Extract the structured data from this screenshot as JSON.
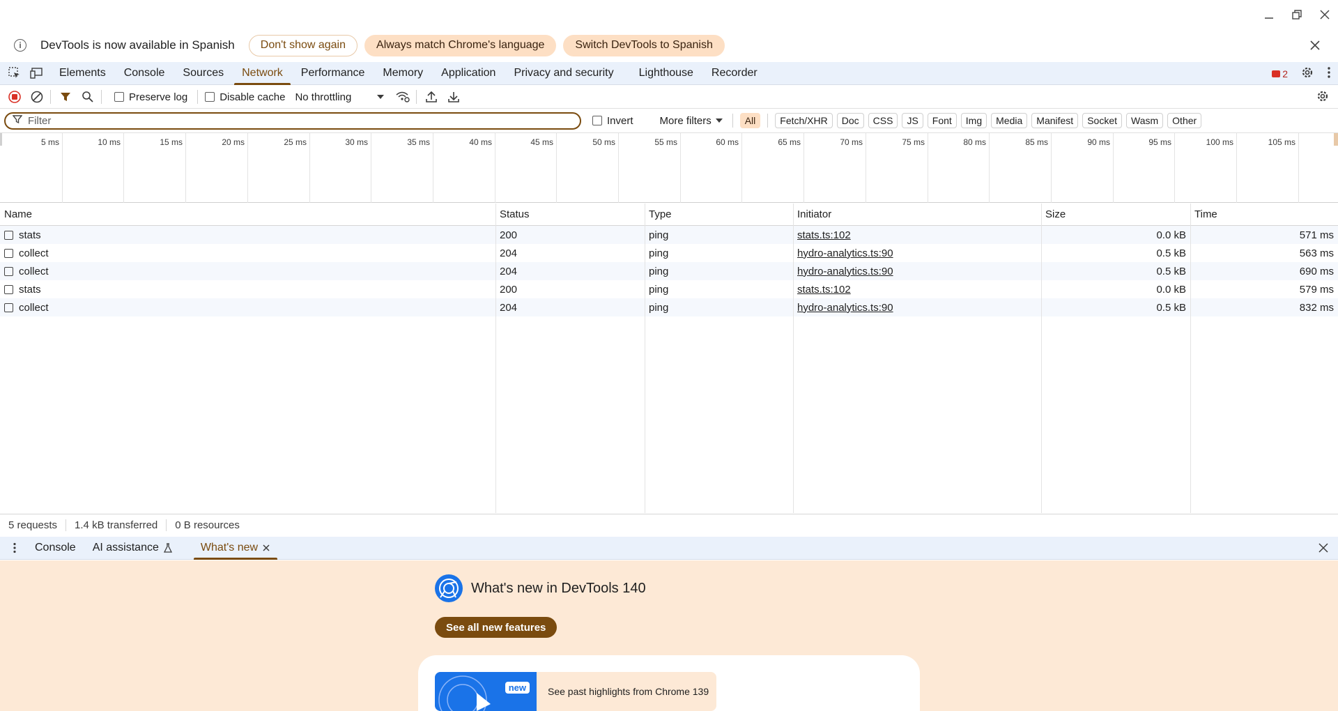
{
  "infobar": {
    "message": "DevTools is now available in Spanish",
    "dont_show": "Don't show again",
    "always_match": "Always match Chrome's language",
    "switch": "Switch DevTools to Spanish"
  },
  "tabs": [
    "Elements",
    "Console",
    "Sources",
    "Network",
    "Performance",
    "Memory",
    "Application",
    "Privacy and security",
    "Lighthouse",
    "Recorder"
  ],
  "active_tab": "Network",
  "issues_count": "2",
  "toolbar": {
    "preserve_log": "Preserve log",
    "disable_cache": "Disable cache",
    "throttling": "No throttling"
  },
  "filter": {
    "placeholder": "Filter",
    "invert": "Invert",
    "more_filters": "More filters",
    "types": [
      "All",
      "Fetch/XHR",
      "Doc",
      "CSS",
      "JS",
      "Font",
      "Img",
      "Media",
      "Manifest",
      "Socket",
      "Wasm",
      "Other"
    ],
    "active_type": "All"
  },
  "overview_ticks": [
    "5 ms",
    "10 ms",
    "15 ms",
    "20 ms",
    "25 ms",
    "30 ms",
    "35 ms",
    "40 ms",
    "45 ms",
    "50 ms",
    "55 ms",
    "60 ms",
    "65 ms",
    "70 ms",
    "75 ms",
    "80 ms",
    "85 ms",
    "90 ms",
    "95 ms",
    "100 ms",
    "105 ms"
  ],
  "table": {
    "headers": {
      "name": "Name",
      "status": "Status",
      "type": "Type",
      "initiator": "Initiator",
      "size": "Size",
      "time": "Time"
    },
    "rows": [
      {
        "name": "stats",
        "status": "200",
        "type": "ping",
        "initiator": "stats.ts:102",
        "size": "0.0 kB",
        "time": "571 ms"
      },
      {
        "name": "collect",
        "status": "204",
        "type": "ping",
        "initiator": "hydro-analytics.ts:90",
        "size": "0.5 kB",
        "time": "563 ms"
      },
      {
        "name": "collect",
        "status": "204",
        "type": "ping",
        "initiator": "hydro-analytics.ts:90",
        "size": "0.5 kB",
        "time": "690 ms"
      },
      {
        "name": "stats",
        "status": "200",
        "type": "ping",
        "initiator": "stats.ts:102",
        "size": "0.0 kB",
        "time": "579 ms"
      },
      {
        "name": "collect",
        "status": "204",
        "type": "ping",
        "initiator": "hydro-analytics.ts:90",
        "size": "0.5 kB",
        "time": "832 ms"
      }
    ]
  },
  "statusbar": {
    "requests": "5 requests",
    "transferred": "1.4 kB transferred",
    "resources": "0 B resources"
  },
  "drawer": {
    "tabs": [
      "Console",
      "AI assistance",
      "What's new"
    ],
    "active": "What's new"
  },
  "whats_new": {
    "title": "What's new in DevTools 140",
    "button": "See all new features",
    "badge": "new",
    "highlight": "See past highlights from Chrome 139"
  },
  "colors": {
    "accent": "#7a4b0f",
    "tab_bg": "#eaf1fb",
    "panel_bg": "#fde9d6",
    "chip_active": "#fddfc4"
  }
}
